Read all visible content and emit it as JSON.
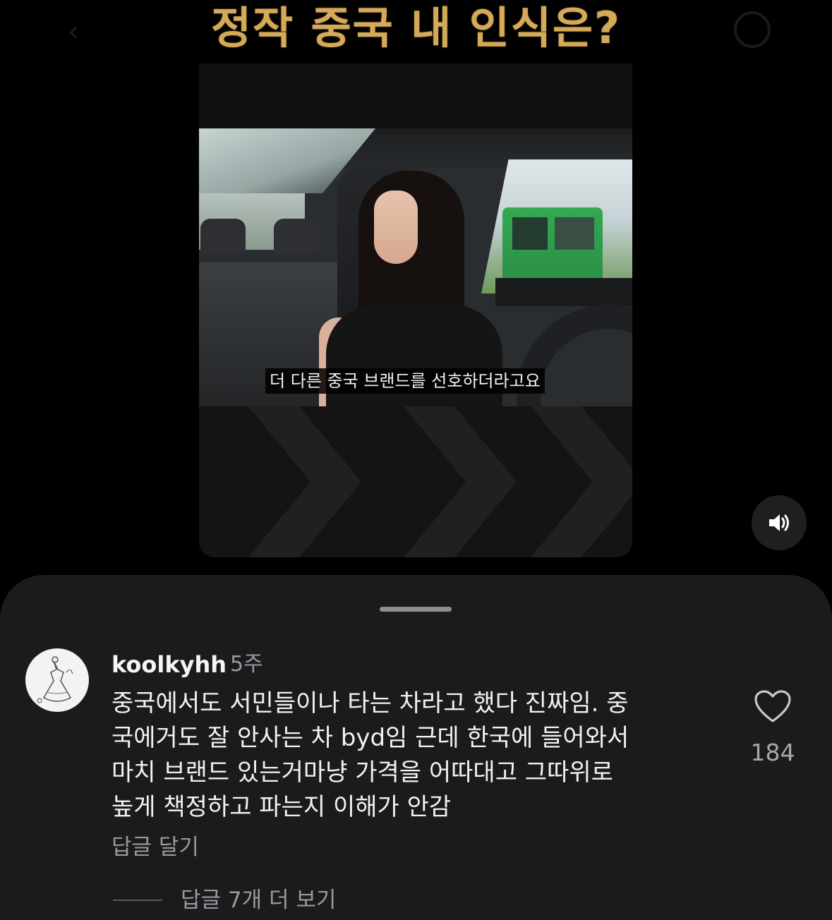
{
  "video": {
    "title": "정작 중국 내 인식은?",
    "subtitle": "더 다른 중국 브랜드를 선호하더라고요",
    "sound_icon": "speaker-icon"
  },
  "comment": {
    "username": "koolkyhh",
    "timestamp": "5주",
    "lines": [
      "중국에서도 서민들이나 타는 차라고 했다 진짜임. 중",
      "국에거도 잘 안사는 차 byd임 근데 한국에 들어와서",
      "마치 브랜드 있는거마냥 가격을 어따대고 그따위로",
      "높게 책정하고 파는지 이해가 안감"
    ],
    "reply_label": "답글 달기",
    "like_icon": "heart-icon",
    "like_count": "184",
    "more_replies_label": "답글 7개 더 보기"
  },
  "colors": {
    "title_gold": "#d4aa5a",
    "sheet_bg": "#1b1b1d",
    "muted_text": "#9a9a9e"
  }
}
